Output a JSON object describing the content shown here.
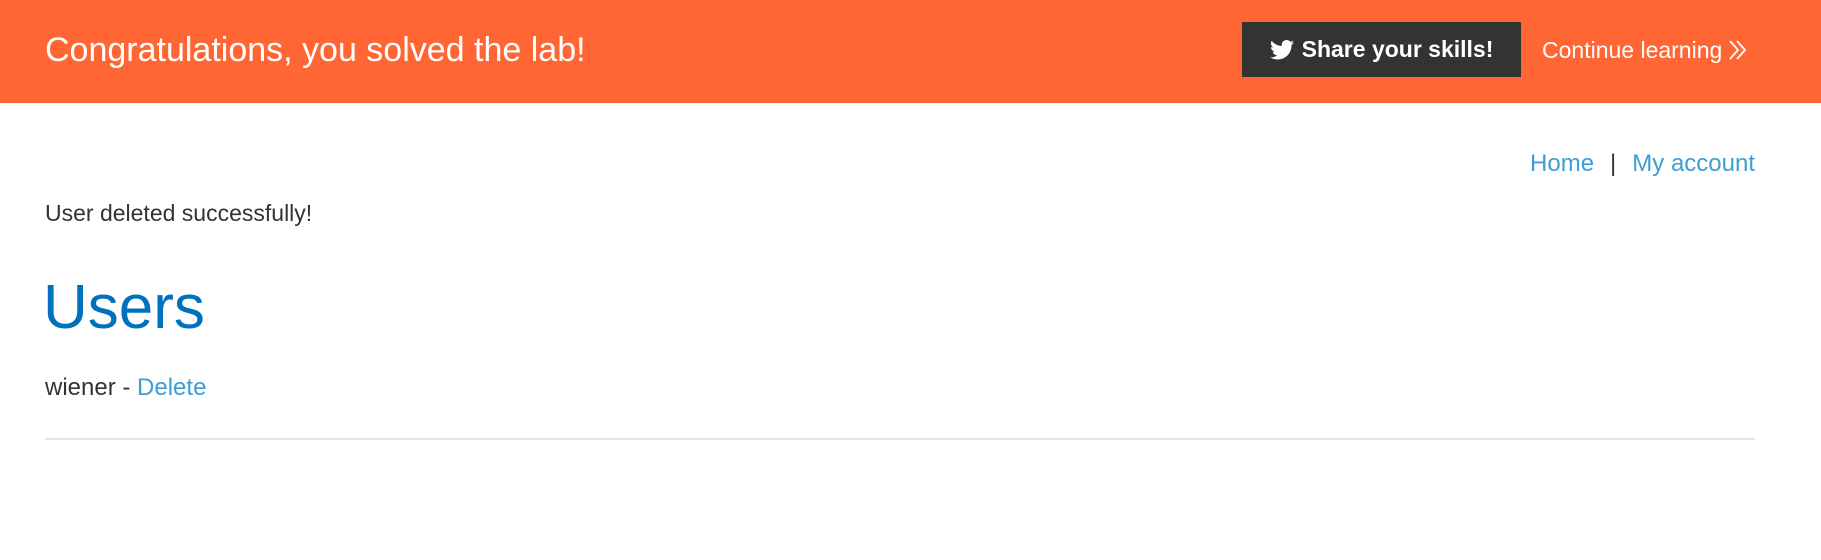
{
  "banner": {
    "title": "Congratulations, you solved the lab!",
    "share_label": "Share your skills!",
    "share_icon": "twitter-icon",
    "continue_label": "Continue learning",
    "continue_icon": "double-chevron-right-icon",
    "background_color": "#ff6633",
    "button_color": "#333332"
  },
  "nav": {
    "home_label": "Home",
    "separator": "|",
    "account_label": "My account",
    "link_color": "#3d9ed3"
  },
  "main": {
    "message": "User deleted successfully!",
    "heading": "Users",
    "heading_color": "#0071bc",
    "users": [
      {
        "name": "wiener",
        "separator": "-",
        "action_label": "Delete"
      }
    ]
  }
}
